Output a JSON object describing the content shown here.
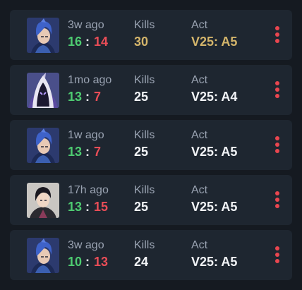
{
  "colors": {
    "win": "#4ecb71",
    "loss": "#e94d57",
    "highlight": "#d4b56b",
    "default_value": "#f2f4f7",
    "label": "#9aa3b2",
    "menu_dots": "#e9464f"
  },
  "labels": {
    "kills": "Kills",
    "act": "Act",
    "separator": ":"
  },
  "matches": [
    {
      "agent_icon": "agent-portrait-blue-hair-icon",
      "time_ago": "3w ago",
      "score_win": "16",
      "score_loss": "14",
      "kills": "30",
      "act": "V25: A5",
      "highlight": true
    },
    {
      "agent_icon": "agent-portrait-hooded-icon",
      "time_ago": "1mo ago",
      "score_win": "13",
      "score_loss": "7",
      "kills": "25",
      "act": "V25: A4",
      "highlight": false
    },
    {
      "agent_icon": "agent-portrait-blue-hair-icon",
      "time_ago": "1w ago",
      "score_win": "13",
      "score_loss": "7",
      "kills": "25",
      "act": "V25: A5",
      "highlight": false
    },
    {
      "agent_icon": "agent-portrait-dark-hair-icon",
      "time_ago": "17h ago",
      "score_win": "13",
      "score_loss": "15",
      "kills": "25",
      "act": "V25: A5",
      "highlight": false
    },
    {
      "agent_icon": "agent-portrait-blue-hair-icon",
      "time_ago": "3w ago",
      "score_win": "10",
      "score_loss": "13",
      "kills": "24",
      "act": "V25: A5",
      "highlight": false
    }
  ]
}
